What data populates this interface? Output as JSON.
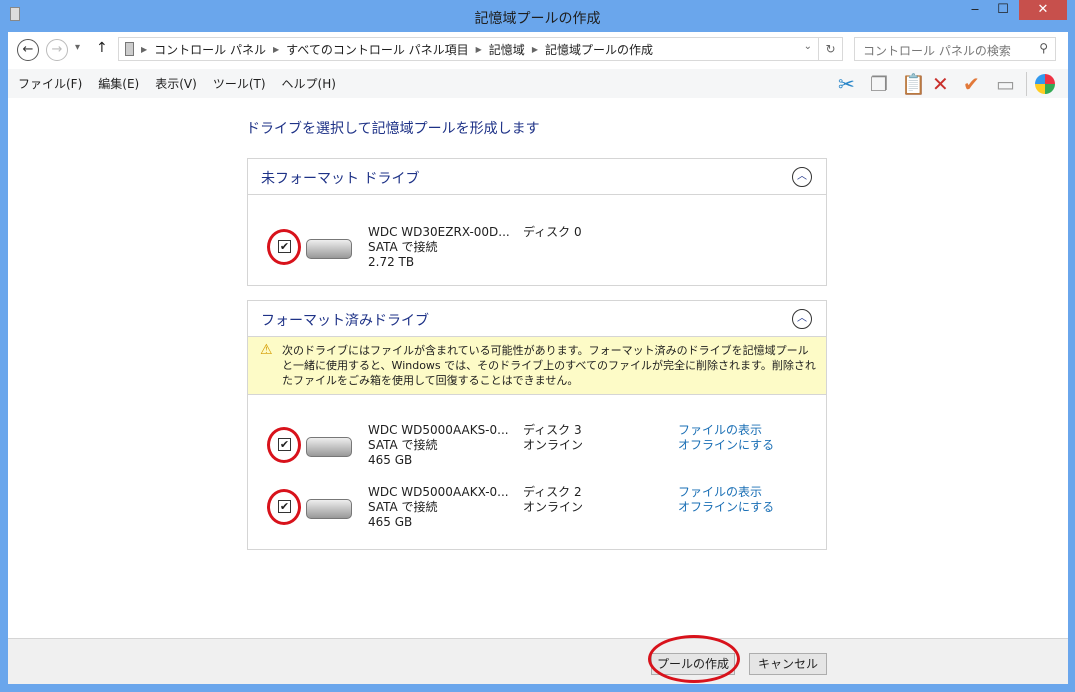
{
  "window": {
    "title": "記憶域プールの作成",
    "minimize": "‒",
    "maximize": "☐",
    "close": "✕"
  },
  "nav": {
    "back": "←",
    "forward": "→",
    "recent": "▾",
    "up": "↑",
    "breadcrumb": [
      "コントロール パネル",
      "すべてのコントロール パネル項目",
      "記憶域",
      "記憶域プールの作成"
    ],
    "search_placeholder": "コントロール パネルの検索"
  },
  "menu": [
    "ファイル(F)",
    "編集(E)",
    "表示(V)",
    "ツール(T)",
    "ヘルプ(H)"
  ],
  "toolbar_icons": [
    "scissors-icon",
    "copy-icon",
    "paste-icon",
    "delete-icon",
    "check-icon",
    "properties-icon",
    "colors-icon"
  ],
  "heading": "ドライブを選択して記憶域プールを形成します",
  "unformatted": {
    "title": "未フォーマット ドライブ",
    "drives": [
      {
        "name": "WDC WD30EZRX-00D...",
        "conn": "SATA で接続",
        "size": "2.72 TB",
        "disk": "ディスク 0",
        "checked": true
      }
    ]
  },
  "formatted": {
    "title": "フォーマット済みドライブ",
    "warning": "次のドライブにはファイルが含まれている可能性があります。フォーマット済みのドライブを記憶域プールと一緒に使用すると、Windows では、そのドライブ上のすべてのファイルが完全に削除されます。削除されたファイルをごみ箱を使用して回復することはできません。",
    "drives": [
      {
        "name": "WDC WD5000AAKS-0...",
        "conn": "SATA で接続",
        "size": "465 GB",
        "disk": "ディスク 3",
        "status": "オンライン",
        "link1": "ファイルの表示",
        "link2": "オフラインにする",
        "checked": true
      },
      {
        "name": "WDC WD5000AAKX-0...",
        "conn": "SATA で接続",
        "size": "465 GB",
        "disk": "ディスク 2",
        "status": "オンライン",
        "link1": "ファイルの表示",
        "link2": "オフラインにする",
        "checked": true
      }
    ]
  },
  "footer": {
    "create": "プールの作成",
    "cancel": "キャンセル"
  },
  "colors": {
    "frame": "#6aa6ec",
    "link": "#1a6fb5",
    "heading": "#1e3287",
    "highlight": "#d8121b"
  }
}
